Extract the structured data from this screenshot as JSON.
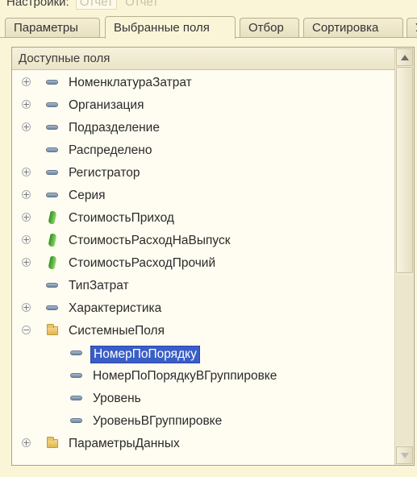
{
  "settings": {
    "label": "Настройки:",
    "value": "Отчет",
    "value2": "Отчет"
  },
  "tabs": [
    {
      "label": "Параметры",
      "active": false
    },
    {
      "label": "Выбранные поля",
      "active": true
    },
    {
      "label": "Отбор",
      "active": false
    },
    {
      "label": "Сортировка",
      "active": false
    },
    {
      "label": "У",
      "active": false
    }
  ],
  "tree": {
    "header": "Доступные поля",
    "items": [
      {
        "label": "НоменклатураЗатрат",
        "icon": "dimension-icon",
        "expandable": true,
        "level": 0
      },
      {
        "label": "Организация",
        "icon": "dimension-icon",
        "expandable": true,
        "level": 0
      },
      {
        "label": "Подразделение",
        "icon": "dimension-icon",
        "expandable": true,
        "level": 0
      },
      {
        "label": "Распределено",
        "icon": "dimension-icon",
        "expandable": false,
        "level": 0
      },
      {
        "label": "Регистратор",
        "icon": "dimension-icon",
        "expandable": true,
        "level": 0
      },
      {
        "label": "Серия",
        "icon": "dimension-icon",
        "expandable": true,
        "level": 0
      },
      {
        "label": "СтоимостьПриход",
        "icon": "resource-icon",
        "expandable": true,
        "level": 0
      },
      {
        "label": "СтоимостьРасходНаВыпуск",
        "icon": "resource-icon",
        "expandable": true,
        "level": 0
      },
      {
        "label": "СтоимостьРасходПрочий",
        "icon": "resource-icon",
        "expandable": true,
        "level": 0
      },
      {
        "label": "ТипЗатрат",
        "icon": "dimension-icon",
        "expandable": false,
        "level": 0
      },
      {
        "label": "Характеристика",
        "icon": "dimension-icon",
        "expandable": true,
        "level": 0
      },
      {
        "label": "СистемныеПоля",
        "icon": "folder-icon",
        "expandable": true,
        "expanded": true,
        "level": 0
      },
      {
        "label": "НомерПоПорядку",
        "icon": "dimension-icon",
        "expandable": false,
        "level": 1,
        "selected": true
      },
      {
        "label": "НомерПоПорядкуВГруппировке",
        "icon": "dimension-icon",
        "expandable": false,
        "level": 1
      },
      {
        "label": "Уровень",
        "icon": "dimension-icon",
        "expandable": false,
        "level": 1
      },
      {
        "label": "УровеньВГруппировке",
        "icon": "dimension-icon",
        "expandable": false,
        "level": 1
      },
      {
        "label": "ПараметрыДанных",
        "icon": "folder-icon",
        "expandable": true,
        "level": 0
      }
    ]
  },
  "colors": {
    "background": "#fbf5d8",
    "selection": "#3a5ec8",
    "resource_icon": "#3a9e24"
  }
}
